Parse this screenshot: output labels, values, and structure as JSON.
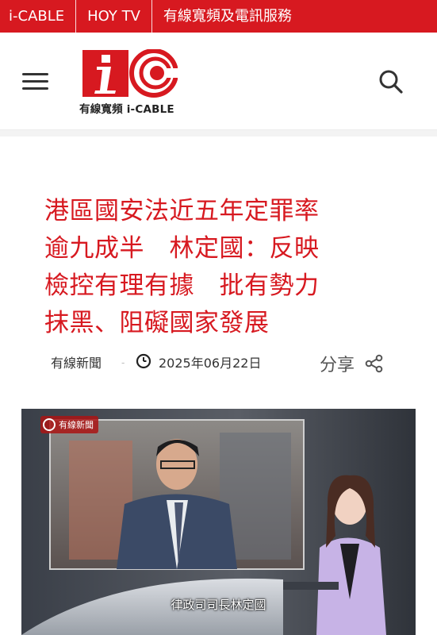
{
  "topbar": {
    "links": [
      "i-CABLE",
      "HOY TV",
      "有線寬頻及電訊服務"
    ],
    "bg_color": "#d71920"
  },
  "header": {
    "menu_icon": "hamburger-menu-icon",
    "logo_tagline": "有線寬頻 i-CABLE",
    "search_icon": "search-icon",
    "brand_color": "#d71920"
  },
  "article": {
    "title": "港區國安法近五年定罪率\n逾九成半　林定國：反映\n檢控有理有據　批有勢力\n抹黑、阻礙國家發展",
    "source": "有線新聞",
    "separator": "-",
    "date": "2025年06月22日",
    "share_label": "分享",
    "share_icon": "share-icon",
    "clock_icon": "clock-icon"
  },
  "video": {
    "channel_label": "有線新聞",
    "subtitle": "律政司司長林定國"
  }
}
